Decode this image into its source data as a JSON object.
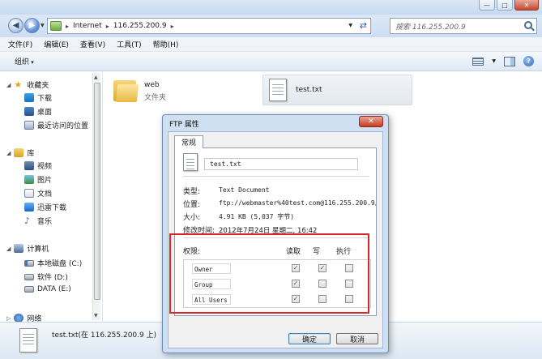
{
  "window": {
    "controls": [
      "—",
      "□",
      "✕"
    ]
  },
  "address": {
    "crumbs": [
      "Internet",
      "116.255.200.9"
    ],
    "search_placeholder": "搜索 116.255.200.9"
  },
  "menu": [
    "文件(F)",
    "编辑(E)",
    "查看(V)",
    "工具(T)",
    "帮助(H)"
  ],
  "toolbar": {
    "organize": "组织"
  },
  "nav": {
    "favorites": "收藏夹",
    "downloads": "下载",
    "desktop": "桌面",
    "recent": "最近访问的位置",
    "libraries": "库",
    "videos": "视频",
    "pictures": "图片",
    "documents": "文档",
    "thunder": "迅雷下载",
    "music": "音乐",
    "computer": "计算机",
    "disk_c": "本地磁盘 (C:)",
    "disk_d": "软件 (D:)",
    "disk_e": "DATA (E:)",
    "network": "网络"
  },
  "files": {
    "folder_name": "web",
    "folder_type": "文件夹",
    "txt_name": "test.txt"
  },
  "details": {
    "text": "test.txt(在 116.255.200.9 上)"
  },
  "dialog": {
    "title": "FTP 属性",
    "close": "✕",
    "tab": "常规",
    "filename": "test.txt",
    "props": [
      {
        "label": "类型:",
        "value": "Text Document"
      },
      {
        "label": "位置:",
        "value": "ftp://webmaster%40test.com@116.255.200.9/te"
      },
      {
        "label": "大小:",
        "value": "4.91 KB (5,037 字节)"
      },
      {
        "label": "修改时间:",
        "value": "2012年7月24日 星期二, 16:42"
      }
    ],
    "perm_header": {
      "label": "权限:",
      "read": "读取",
      "write": "写",
      "exec": "执行"
    },
    "perms": [
      {
        "name": "Owner",
        "read": "✓",
        "write": "✓",
        "exec": ""
      },
      {
        "name": "Group",
        "read": "✓",
        "write": "",
        "exec": ""
      },
      {
        "name": "All Users",
        "read": "✓",
        "write": "",
        "exec": ""
      }
    ],
    "ok": "确定",
    "cancel": "取消"
  },
  "colors": {
    "highlight_frame": "#d9262a",
    "title_gradient": "#c7daf0"
  }
}
